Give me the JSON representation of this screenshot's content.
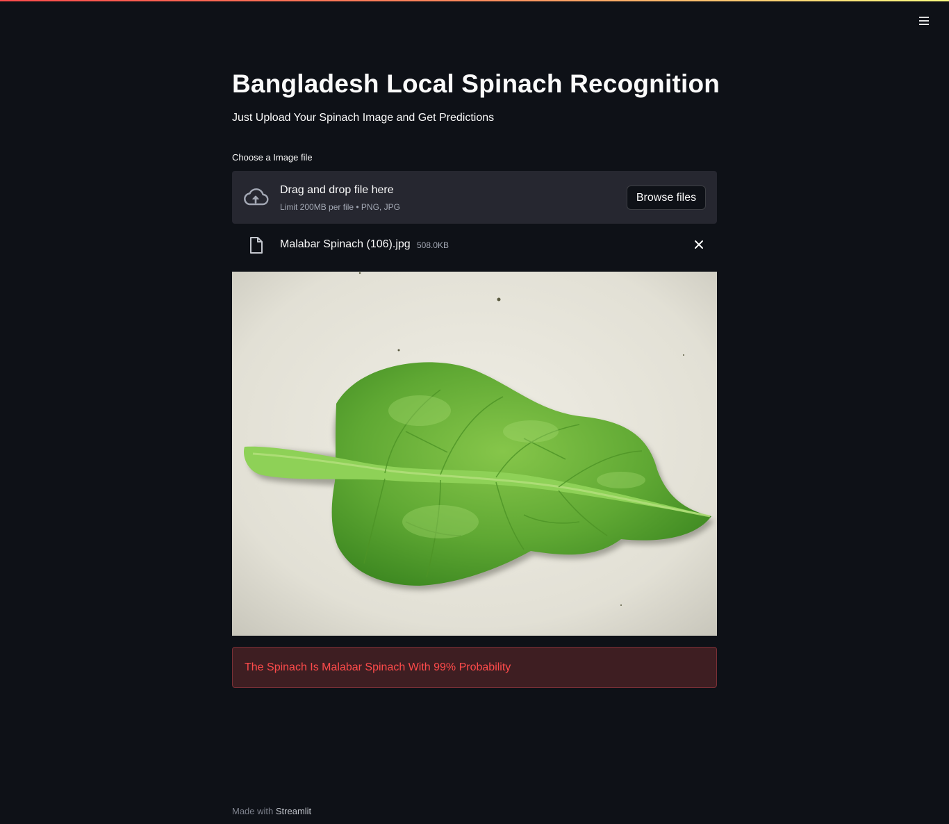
{
  "header": {
    "menu_icon": "hamburger-menu-icon"
  },
  "main": {
    "title": "Bangladesh Local Spinach Recognition",
    "subtitle": "Just Upload Your Spinach Image and Get Predictions"
  },
  "uploader": {
    "label": "Choose a Image file",
    "icon": "cloud-upload-icon",
    "drop_text": "Drag and drop file here",
    "limit_text": "Limit 200MB per file • PNG, JPG",
    "browse_label": "Browse files"
  },
  "file": {
    "icon": "file-icon",
    "name": "Malabar Spinach (106).jpg",
    "size": "508.0KB",
    "remove_icon": "close-icon"
  },
  "image": {
    "subject": "spinach-leaf-photo"
  },
  "result": {
    "text": "The Spinach Is Malabar Spinach With 99% Probability"
  },
  "footer": {
    "prefix": "Made with",
    "link": "Streamlit"
  },
  "colors": {
    "background": "#0e1117",
    "panel": "#262730",
    "error_text": "#ff4b4b",
    "error_bg": "#3e1e22"
  }
}
